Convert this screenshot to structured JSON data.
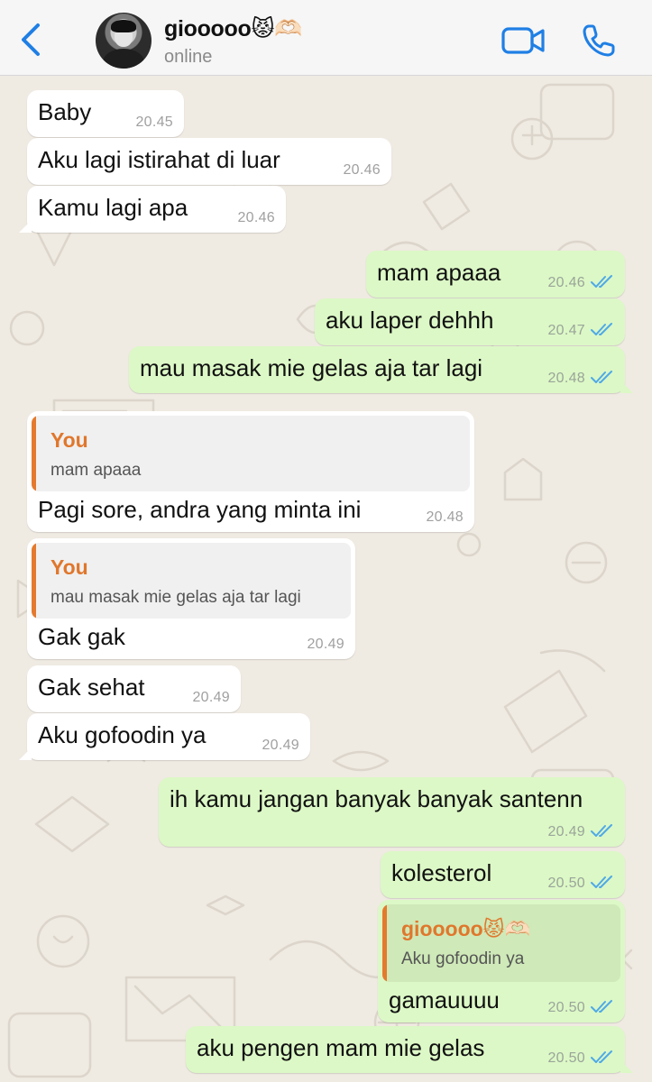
{
  "header": {
    "contact_name": "giooooo😾🫶🏻",
    "status": "online"
  },
  "colors": {
    "accent": "#1f7fe5",
    "incoming_bubble": "#ffffff",
    "outgoing_bubble": "#dcf8c6",
    "quote_author": "#e0772c",
    "background": "#efeae2"
  },
  "icons": {
    "back": "chevron-left-icon",
    "video": "video-camera-icon",
    "call": "phone-icon",
    "read_receipt": "double-check-icon"
  },
  "messages": [
    {
      "dir": "in",
      "text": "Baby",
      "time": "20.45"
    },
    {
      "dir": "in",
      "text": "Aku lagi istirahat di luar",
      "time": "20.46"
    },
    {
      "dir": "in",
      "text": "Kamu lagi apa",
      "time": "20.46"
    },
    {
      "dir": "out",
      "text": "mam apaaa",
      "time": "20.46"
    },
    {
      "dir": "out",
      "text": "aku laper dehhh",
      "time": "20.47"
    },
    {
      "dir": "out",
      "text": "mau masak mie gelas aja tar lagi",
      "time": "20.48"
    },
    {
      "dir": "in",
      "reply_author": "You",
      "reply_text": "mam apaaa",
      "text": "Pagi sore, andra yang minta ini",
      "time": "20.48"
    },
    {
      "dir": "in",
      "reply_author": "You",
      "reply_text": "mau masak mie gelas aja tar lagi",
      "text": "Gak gak",
      "time": "20.49"
    },
    {
      "dir": "in",
      "text": "Gak sehat",
      "time": "20.49"
    },
    {
      "dir": "in",
      "text": "Aku gofoodin ya",
      "time": "20.49"
    },
    {
      "dir": "out",
      "text": "ih kamu jangan banyak banyak santenn",
      "time": "20.49"
    },
    {
      "dir": "out",
      "text": "kolesterol",
      "time": "20.50"
    },
    {
      "dir": "out",
      "reply_author": "giooooo😾🫶🏻",
      "reply_text": "Aku gofoodin ya",
      "text": "gamauuuu",
      "time": "20.50"
    },
    {
      "dir": "out",
      "text": "aku pengen mam mie gelas",
      "time": "20.50"
    }
  ]
}
